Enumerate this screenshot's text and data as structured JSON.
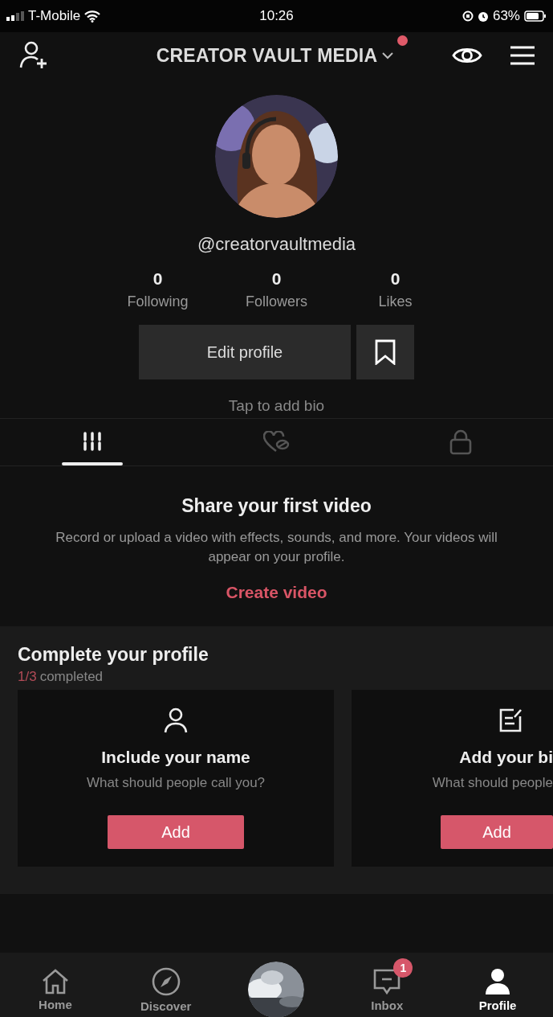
{
  "status_bar": {
    "carrier": "T-Mobile",
    "time": "10:26",
    "battery": "63%"
  },
  "header": {
    "title": "CREATOR VAULT MEDIA",
    "notification_dot": true
  },
  "profile": {
    "handle": "@creatorvaultmedia",
    "stats": [
      {
        "value": "0",
        "label": "Following"
      },
      {
        "value": "0",
        "label": "Followers"
      },
      {
        "value": "0",
        "label": "Likes"
      }
    ],
    "edit_button": "Edit profile",
    "bio_placeholder": "Tap to add bio"
  },
  "tabs": [
    {
      "kind": "videos",
      "selected": true
    },
    {
      "kind": "liked",
      "selected": false
    },
    {
      "kind": "private",
      "selected": false
    }
  ],
  "empty_state": {
    "title": "Share your first video",
    "text": "Record or upload a video with effects, sounds, and more. Your videos will appear on your profile.",
    "action": "Create video"
  },
  "complete_profile": {
    "title": "Complete your profile",
    "progress_count": "1/3",
    "progress_label": "completed",
    "cards": [
      {
        "kind": "name",
        "title": "Include your name",
        "subtitle": "What should people call you?",
        "button": "Add"
      },
      {
        "kind": "bio",
        "title": "Add your bi",
        "subtitle": "What should people",
        "button": "Add"
      }
    ]
  },
  "bottom_nav": [
    {
      "kind": "home",
      "label": "Home",
      "selected": false
    },
    {
      "kind": "discover",
      "label": "Discover",
      "selected": false
    },
    {
      "kind": "create"
    },
    {
      "kind": "inbox",
      "label": "Inbox",
      "badge": "1",
      "selected": false
    },
    {
      "kind": "profile",
      "label": "Profile",
      "selected": true
    }
  ]
}
